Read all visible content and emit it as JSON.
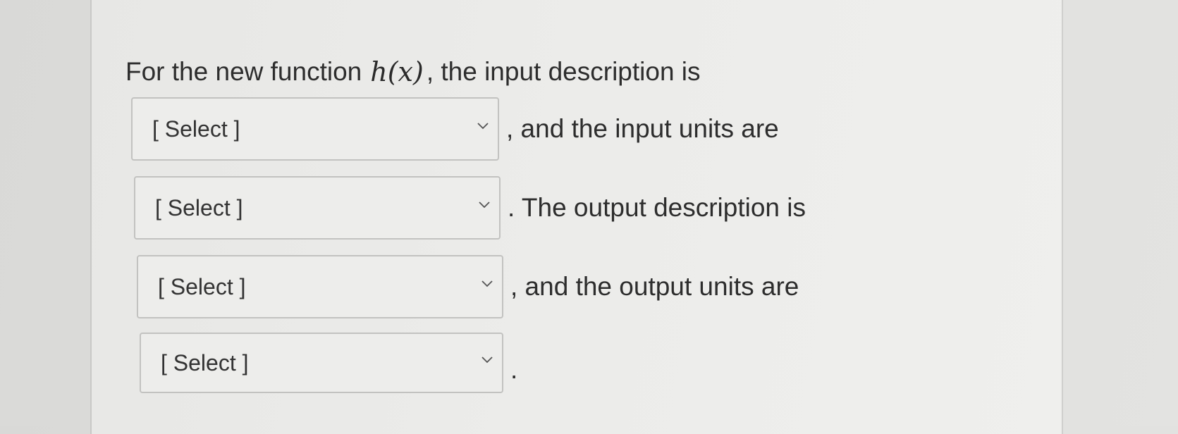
{
  "question": {
    "intro_text": "For the new function",
    "function_name": "h(x)",
    "intro_tail": ", the input description is",
    "blanks": [
      {
        "selected": "[ Select ]",
        "trailing_text": ", and the input units are"
      },
      {
        "selected": "[ Select ]",
        "trailing_text": ". The output description is"
      },
      {
        "selected": "[ Select ]",
        "trailing_text": ", and the output units are"
      },
      {
        "selected": "[ Select ]",
        "trailing_text": "."
      }
    ]
  },
  "icons": {
    "dropdown": "chevron-down-icon"
  },
  "colors": {
    "text": "#2d2d2d",
    "select_border": "#c2c2c0",
    "background": "#ececea"
  }
}
